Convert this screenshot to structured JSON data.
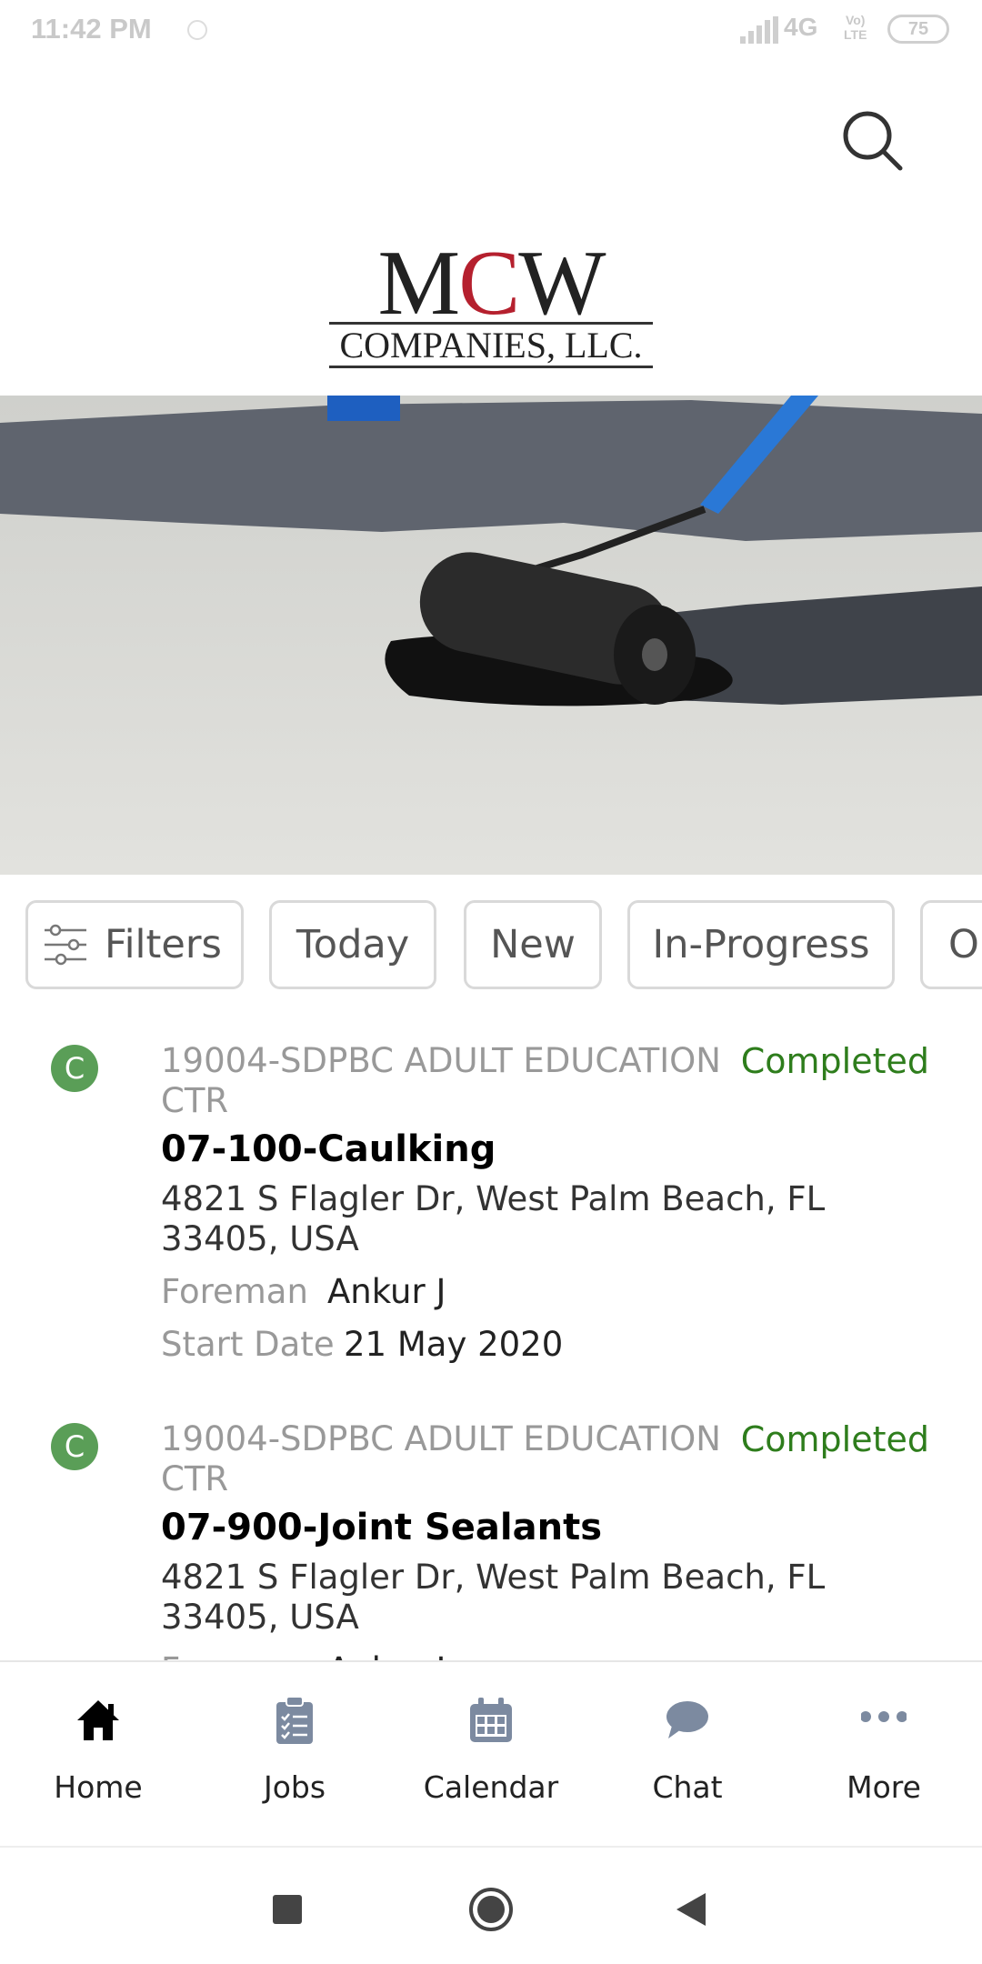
{
  "status_bar": {
    "time": "11:42 PM",
    "network": "4G",
    "volte_top": "Vo)",
    "volte_bottom": "LTE",
    "battery": "75"
  },
  "header": {
    "logo_line1_a": "M",
    "logo_line1_b": "C",
    "logo_line1_c": "W",
    "logo_line2": "COMPANIES, LLC.",
    "search_icon": "search-icon"
  },
  "carousel": {
    "active_index": 1,
    "dot_count": 4
  },
  "filters": {
    "chips": [
      {
        "label": "Filters",
        "icon": "sliders-icon"
      },
      {
        "label": "Today"
      },
      {
        "label": "New"
      },
      {
        "label": "In-Progress"
      },
      {
        "label": "O"
      }
    ]
  },
  "jobs": [
    {
      "badge": "C",
      "project": "19004-SDPBC ADULT EDUCATION CTR",
      "status": "Completed",
      "title": "07-100-Caulking",
      "address": "4821 S Flagler Dr, West Palm Beach, FL 33405, USA",
      "foreman_label": "Foreman",
      "foreman": "Ankur J",
      "start_label": "Start Date",
      "start_date": "21 May 2020"
    },
    {
      "badge": "C",
      "project": "19004-SDPBC ADULT EDUCATION CTR",
      "status": "Completed",
      "title": "07-900-Joint Sealants",
      "address": "4821 S Flagler Dr, West Palm Beach, FL 33405, USA",
      "foreman_label": "Foreman",
      "foreman": "Ankur J"
    }
  ],
  "bottom_nav": [
    {
      "label": "Home",
      "icon": "home-icon",
      "active": true
    },
    {
      "label": "Jobs",
      "icon": "clipboard-icon",
      "active": false
    },
    {
      "label": "Calendar",
      "icon": "calendar-icon",
      "active": false
    },
    {
      "label": "Chat",
      "icon": "chat-icon",
      "active": false
    },
    {
      "label": "More",
      "icon": "more-icon",
      "active": false
    }
  ],
  "colors": {
    "accent_blue": "#1a73e8",
    "status_green": "#2e7d1c",
    "badge_green": "#5a9e57",
    "logo_red": "#b5202e"
  }
}
